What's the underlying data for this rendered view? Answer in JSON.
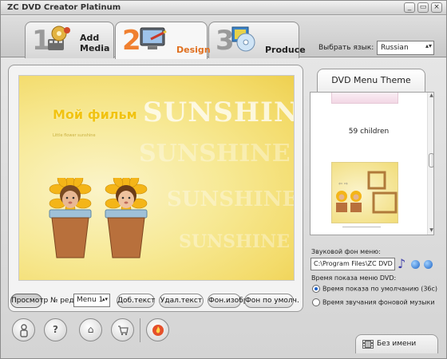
{
  "window": {
    "title": "ZC DVD Creator Platinum",
    "minimize_glyph": "_",
    "maximize_glyph": "▭",
    "close_glyph": "×"
  },
  "tabs": [
    {
      "number": "1",
      "label_line1": "Add",
      "label_line2": "Media",
      "icon": "film-reel-icon"
    },
    {
      "number": "2",
      "label_line1": "Design",
      "icon": "monitor-brush-icon"
    },
    {
      "number": "3",
      "label_line1": "Produce",
      "icon": "dvd-disc-icon"
    }
  ],
  "language": {
    "label": "Выбрать язык:",
    "value": "Russian"
  },
  "preview": {
    "movie_title": "Мой фильм",
    "background_word": "SUNSHINE",
    "caption": "Little flower sunshine"
  },
  "toolbar": {
    "preview_label": "Просмотр",
    "menu_no_label": "№ ред.",
    "menu_value": "Menu 1",
    "add_text_label": "Доб.текст",
    "delete_text_label": "Удал.текст",
    "bg_image_label": "Фон.изобр",
    "bg_default_label": "Фон по умолч."
  },
  "theme_panel": {
    "header": "DVD Menu Theme",
    "items": [
      {
        "label": "59 children"
      },
      {
        "label": "Sunshine"
      }
    ]
  },
  "sound": {
    "label": "Звуковой фон меню:",
    "path": "C:\\Program Files\\ZC DVD Cre..."
  },
  "display_time": {
    "label": "Время показа меню DVD:",
    "options": [
      {
        "label": "Время показа по умолчанию (36с)",
        "checked": true
      },
      {
        "label": "Время звучания фоновой музыки",
        "checked": false
      }
    ]
  },
  "status": {
    "project_name": "Без имени"
  },
  "colors": {
    "accent_orange": "#f08030",
    "preview_yellow": "#f7e995",
    "title_yellow": "#f1c312"
  }
}
